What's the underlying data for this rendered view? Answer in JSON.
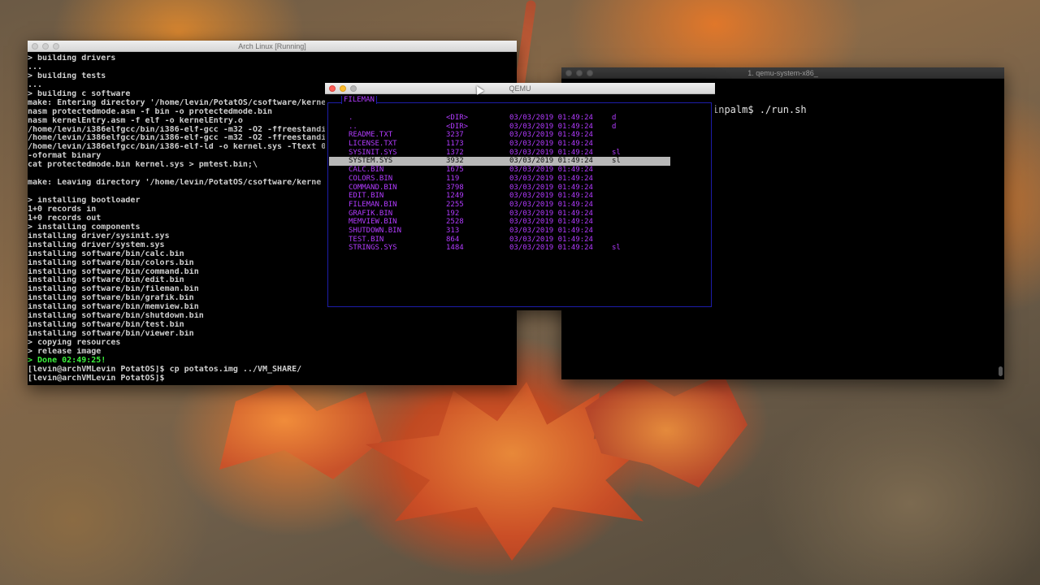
{
  "vbox": {
    "title": "Arch Linux [Running]",
    "lines": [
      "> building drivers",
      "...",
      "> building tests",
      "...",
      "> building c software",
      "make: Entering directory '/home/levin/PotatOS/csoftware/kerne",
      "nasm protectedmode.asm -f bin -o protectedmode.bin",
      "nasm kernelEntry.asm -f elf -o kernelEntry.o",
      "/home/levin/i386elfgcc/bin/i386-elf-gcc -m32 -O2 -ffreestandi",
      "/home/levin/i386elfgcc/bin/i386-elf-gcc -m32 -O2 -ffreestandi",
      "/home/levin/i386elfgcc/bin/i386-elf-ld -o kernel.sys -Ttext 0",
      "-oformat binary",
      "cat protectedmode.bin kernel.sys > pmtest.bin;\\",
      "",
      "make: Leaving directory '/home/levin/PotatOS/csoftware/kerne",
      "",
      "> installing bootloader",
      "1+0 records in",
      "1+0 records out",
      "> installing components",
      "installing driver/sysinit.sys",
      "installing driver/system.sys",
      "installing software/bin/calc.bin",
      "installing software/bin/colors.bin",
      "installing software/bin/command.bin",
      "installing software/bin/edit.bin",
      "installing software/bin/fileman.bin",
      "installing software/bin/grafik.bin",
      "installing software/bin/memview.bin",
      "installing software/bin/shutdown.bin",
      "installing software/bin/test.bin",
      "installing software/bin/viewer.bin",
      "> copying resources",
      "> release image",
      "> Done 02:49:25!",
      "[levin@archVMLevin PotatOS]$ cp potatos.img ../VM_SHARE/",
      "[levin@archVMLevin PotatOS]$"
    ]
  },
  "iterm": {
    "title": "1. qemu-system-x86_",
    "prompt_line": "inpalm$ ./run.sh"
  },
  "qemu": {
    "title": "QEMU",
    "fileman_title": "FILEMAN",
    "rows": [
      {
        "name": ".",
        "size": "<DIR>",
        "date": "03/03/2019 01:49:24",
        "attr": "d"
      },
      {
        "name": "..",
        "size": "<DIR>",
        "date": "03/03/2019 01:49:24",
        "attr": "d"
      },
      {
        "name": "README.TXT",
        "size": "3237",
        "date": "03/03/2019 01:49:24",
        "attr": ""
      },
      {
        "name": "LICENSE.TXT",
        "size": "1173",
        "date": "03/03/2019 01:49:24",
        "attr": ""
      },
      {
        "name": "SYSINIT.SYS",
        "size": "1372",
        "date": "03/03/2019 01:49:24",
        "attr": "sl"
      },
      {
        "name": "SYSTEM.SYS",
        "size": "3932",
        "date": "03/03/2019 01:49:24",
        "attr": "sl"
      },
      {
        "name": "CALC.BIN",
        "size": "1675",
        "date": "03/03/2019 01:49:24",
        "attr": ""
      },
      {
        "name": "COLORS.BIN",
        "size": "119",
        "date": "03/03/2019 01:49:24",
        "attr": ""
      },
      {
        "name": "COMMAND.BIN",
        "size": "3798",
        "date": "03/03/2019 01:49:24",
        "attr": ""
      },
      {
        "name": "EDIT.BIN",
        "size": "1249",
        "date": "03/03/2019 01:49:24",
        "attr": ""
      },
      {
        "name": "FILEMAN.BIN",
        "size": "2255",
        "date": "03/03/2019 01:49:24",
        "attr": ""
      },
      {
        "name": "GRAFIK.BIN",
        "size": "192",
        "date": "03/03/2019 01:49:24",
        "attr": ""
      },
      {
        "name": "MEMVIEW.BIN",
        "size": "2528",
        "date": "03/03/2019 01:49:24",
        "attr": ""
      },
      {
        "name": "SHUTDOWN.BIN",
        "size": "313",
        "date": "03/03/2019 01:49:24",
        "attr": ""
      },
      {
        "name": "TEST.BIN",
        "size": "864",
        "date": "03/03/2019 01:49:24",
        "attr": ""
      },
      {
        "name": "STRINGS.SYS",
        "size": "1484",
        "date": "03/03/2019 01:49:24",
        "attr": "sl"
      }
    ],
    "selected_index": 5
  }
}
